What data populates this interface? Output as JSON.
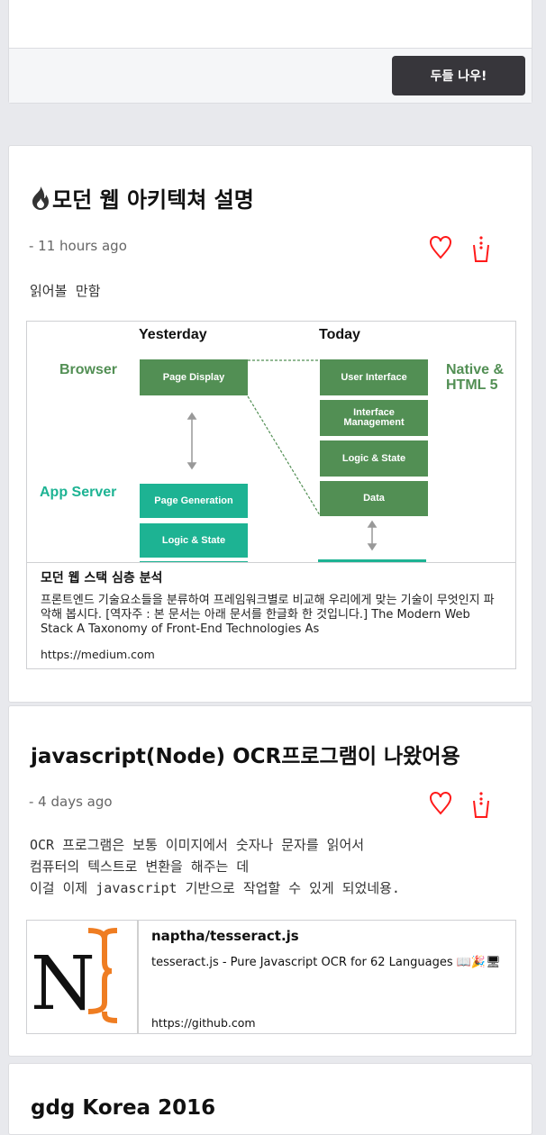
{
  "top_card": {
    "button_label": "두들 나우!"
  },
  "posts": [
    {
      "title": "모던 웹 아키텍쳐 설명",
      "title_icon": "fire-icon",
      "time": "- 11 hours ago",
      "body": "읽어볼  만함",
      "like_icon": "heart-icon",
      "share_icon": "cup-icon",
      "preview": {
        "diagram": {
          "col_yesterday": "Yesterday",
          "col_today": "Today",
          "label_browser": "Browser",
          "label_app_server": "App Server",
          "label_native": "Native &",
          "label_html5": "HTML 5",
          "yesterday_boxes": [
            "Page Display",
            "Page Generation",
            "Logic & State"
          ],
          "today_boxes": [
            "User Interface",
            "Interface Management",
            "Logic & State",
            "Data"
          ]
        },
        "title": "모던 웹 스택 심층 분석",
        "description": "프론트엔드 기술요소들을 분류하여 프레임워크별로 비교해 우리에게 맞는 기술이 무엇인지 파악해 봅시다. [역자주 : 본 문서는 아래 문서를 한글화 한 것입니다.] The Modern Web Stack A Taxonomy of Front-End Technologies As",
        "url": "https://medium.com"
      }
    },
    {
      "title": "javascript(Node) OCR프로그램이 나왔어용",
      "time": "- 4 days ago",
      "body_lines": [
        "OCR 프로그램은 보통 이미지에서 숫자나 문자를 읽어서",
        "컴퓨터의 텍스트로 변환을 해주는 데",
        "이걸 이제 javascript 기반으로 작업할 수 있게 되었네용."
      ],
      "like_icon": "heart-icon",
      "share_icon": "cup-icon",
      "preview": {
        "title": "naptha/tesseract.js",
        "description": "tesseract.js - Pure Javascript OCR for 62 Languages 📖🎉🖥",
        "url": "https://github.com"
      }
    },
    {
      "title": "gdg Korea 2016"
    }
  ],
  "colors": {
    "accent_red": "#ff1a1a",
    "button_dark": "#37363b",
    "browser_green": "#528f54",
    "server_teal": "#1db393",
    "logo_orange": "#ef7d22"
  }
}
